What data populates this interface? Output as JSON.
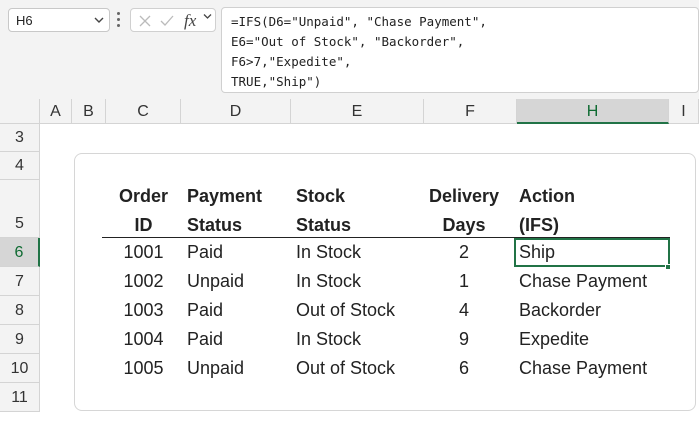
{
  "name_box": {
    "value": "H6"
  },
  "formula_bar": {
    "fx_label": "fx",
    "lines": [
      "=IFS(D6=\"Unpaid\", \"Chase Payment\",",
      "E6=\"Out of Stock\", \"Backorder\",",
      "F6>7,\"Expedite\",",
      "TRUE,\"Ship\")"
    ]
  },
  "columns": [
    "A",
    "B",
    "C",
    "D",
    "E",
    "F",
    "H",
    "I"
  ],
  "rows": [
    "3",
    "4",
    "5",
    "6",
    "7",
    "8",
    "9",
    "10",
    "11"
  ],
  "selected": {
    "column": "H",
    "row": "6"
  },
  "table": {
    "headers": [
      {
        "line1": "Order",
        "line2": "ID"
      },
      {
        "line1": "Payment",
        "line2": "Status"
      },
      {
        "line1": "Stock",
        "line2": "Status"
      },
      {
        "line1": "Delivery",
        "line2": "Days"
      },
      {
        "line1": "Action",
        "line2": "(IFS)"
      }
    ],
    "rows": [
      {
        "order_id": "1001",
        "payment": "Paid",
        "stock": "In Stock",
        "days": "2",
        "action": "Ship"
      },
      {
        "order_id": "1002",
        "payment": "Unpaid",
        "stock": "In Stock",
        "days": "1",
        "action": "Chase Payment"
      },
      {
        "order_id": "1003",
        "payment": "Paid",
        "stock": "Out of Stock",
        "days": "4",
        "action": "Backorder"
      },
      {
        "order_id": "1004",
        "payment": "Paid",
        "stock": "In Stock",
        "days": "9",
        "action": "Expedite"
      },
      {
        "order_id": "1005",
        "payment": "Unpaid",
        "stock": "Out of Stock",
        "days": "6",
        "action": "Chase Payment"
      }
    ]
  },
  "colors": {
    "accent": "#217346"
  }
}
